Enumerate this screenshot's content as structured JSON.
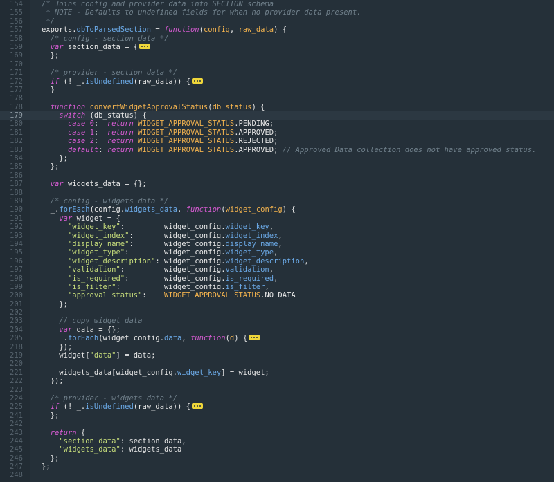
{
  "editor": {
    "active_line": "179",
    "lines": [
      {
        "n": "154",
        "ind": "",
        "t": [
          [
            "/* Joins config and provider data into SECTION schema",
            "c-comment"
          ]
        ]
      },
      {
        "n": "155",
        "ind": " ",
        "t": [
          [
            "* NOTE - Defaults to undefined fields for when no provider data present.",
            "c-comment"
          ]
        ]
      },
      {
        "n": "156",
        "ind": " ",
        "t": [
          [
            "*/",
            "c-comment"
          ]
        ]
      },
      {
        "n": "157",
        "ind": "",
        "t": [
          [
            "exports",
            "c-plain"
          ],
          [
            ".",
            "c-plain"
          ],
          [
            "dbToParsedSection",
            "c-prop"
          ],
          [
            " = ",
            "c-plain"
          ],
          [
            "function",
            "c-kw"
          ],
          [
            "(",
            "c-plain"
          ],
          [
            "config",
            "c-param"
          ],
          [
            ", ",
            "c-plain"
          ],
          [
            "raw_data",
            "c-param"
          ],
          [
            ") {",
            "c-plain"
          ]
        ]
      },
      {
        "n": "158",
        "ind": "  ",
        "t": [
          [
            "/* config - section data */",
            "c-comment"
          ]
        ]
      },
      {
        "n": "159",
        "ind": "  ",
        "t": [
          [
            "var",
            "c-kw"
          ],
          [
            " section_data = {",
            "c-plain"
          ]
        ],
        "fold": true
      },
      {
        "n": "169",
        "ind": "  ",
        "t": [
          [
            "};",
            "c-plain"
          ]
        ]
      },
      {
        "n": "170",
        "ind": "",
        "t": []
      },
      {
        "n": "171",
        "ind": "  ",
        "t": [
          [
            "/* provider - section data */",
            "c-comment"
          ]
        ]
      },
      {
        "n": "172",
        "ind": "  ",
        "t": [
          [
            "if",
            "c-kw"
          ],
          [
            " (! _.",
            "c-plain"
          ],
          [
            "isUndefined",
            "c-prop"
          ],
          [
            "(raw_data)) {",
            "c-plain"
          ]
        ],
        "fold": true
      },
      {
        "n": "177",
        "ind": "  ",
        "t": [
          [
            "}",
            "c-plain"
          ]
        ]
      },
      {
        "n": "178",
        "ind": "",
        "t": []
      },
      {
        "n": "178",
        "ind": "  ",
        "t": [
          [
            "function",
            "c-kw"
          ],
          [
            " ",
            "c-plain"
          ],
          [
            "convertWidgetApprovalStatus",
            "c-func"
          ],
          [
            "(",
            "c-plain"
          ],
          [
            "db_status",
            "c-param"
          ],
          [
            ") {",
            "c-plain"
          ]
        ]
      },
      {
        "n": "179",
        "ind": "    ",
        "t": [
          [
            "switch",
            "c-kw"
          ],
          [
            " (db_status) {",
            "c-plain"
          ]
        ]
      },
      {
        "n": "180",
        "ind": "      ",
        "t": [
          [
            "case",
            "c-kw"
          ],
          [
            " ",
            "c-plain"
          ],
          [
            "0",
            "c-num"
          ],
          [
            ":  ",
            "c-plain"
          ],
          [
            "return",
            "c-kw"
          ],
          [
            " ",
            "c-plain"
          ],
          [
            "WIDGET_APPROVAL_STATUS",
            "c-const"
          ],
          [
            ".PENDING;",
            "c-plain"
          ]
        ]
      },
      {
        "n": "181",
        "ind": "      ",
        "t": [
          [
            "case",
            "c-kw"
          ],
          [
            " ",
            "c-plain"
          ],
          [
            "1",
            "c-num"
          ],
          [
            ":  ",
            "c-plain"
          ],
          [
            "return",
            "c-kw"
          ],
          [
            " ",
            "c-plain"
          ],
          [
            "WIDGET_APPROVAL_STATUS",
            "c-const"
          ],
          [
            ".APPROVED;",
            "c-plain"
          ]
        ]
      },
      {
        "n": "182",
        "ind": "      ",
        "t": [
          [
            "case",
            "c-kw"
          ],
          [
            " ",
            "c-plain"
          ],
          [
            "2",
            "c-num"
          ],
          [
            ":  ",
            "c-plain"
          ],
          [
            "return",
            "c-kw"
          ],
          [
            " ",
            "c-plain"
          ],
          [
            "WIDGET_APPROVAL_STATUS",
            "c-const"
          ],
          [
            ".REJECTED;",
            "c-plain"
          ]
        ]
      },
      {
        "n": "183",
        "ind": "      ",
        "t": [
          [
            "default",
            "c-kw"
          ],
          [
            ": ",
            "c-plain"
          ],
          [
            "return",
            "c-kw"
          ],
          [
            " ",
            "c-plain"
          ],
          [
            "WIDGET_APPROVAL_STATUS",
            "c-const"
          ],
          [
            ".APPROVED; ",
            "c-plain"
          ],
          [
            "// Approved Data collection does not have approved_status.",
            "c-comment"
          ]
        ]
      },
      {
        "n": "184",
        "ind": "    ",
        "t": [
          [
            "};",
            "c-plain"
          ]
        ]
      },
      {
        "n": "185",
        "ind": "  ",
        "t": [
          [
            "};",
            "c-plain"
          ]
        ]
      },
      {
        "n": "186",
        "ind": "",
        "t": []
      },
      {
        "n": "187",
        "ind": "  ",
        "t": [
          [
            "var",
            "c-kw"
          ],
          [
            " widgets_data = {};",
            "c-plain"
          ]
        ]
      },
      {
        "n": "188",
        "ind": "",
        "t": []
      },
      {
        "n": "189",
        "ind": "  ",
        "t": [
          [
            "/* config - widgets data */",
            "c-comment"
          ]
        ]
      },
      {
        "n": "190",
        "ind": "  ",
        "t": [
          [
            "_.",
            "c-plain"
          ],
          [
            "forEach",
            "c-prop"
          ],
          [
            "(config.",
            "c-plain"
          ],
          [
            "widgets_data",
            "c-prop"
          ],
          [
            ", ",
            "c-plain"
          ],
          [
            "function",
            "c-kw"
          ],
          [
            "(",
            "c-plain"
          ],
          [
            "widget_config",
            "c-param"
          ],
          [
            ") {",
            "c-plain"
          ]
        ]
      },
      {
        "n": "191",
        "ind": "    ",
        "t": [
          [
            "var",
            "c-kw"
          ],
          [
            " widget = {",
            "c-plain"
          ]
        ]
      },
      {
        "n": "192",
        "ind": "      ",
        "t": [
          [
            "\"widget_key\"",
            "c-str"
          ],
          [
            ":         widget_config.",
            "c-plain"
          ],
          [
            "widget_key",
            "c-prop"
          ],
          [
            ",",
            "c-plain"
          ]
        ]
      },
      {
        "n": "193",
        "ind": "      ",
        "t": [
          [
            "\"widget_index\"",
            "c-str"
          ],
          [
            ":       widget_config.",
            "c-plain"
          ],
          [
            "widget_index",
            "c-prop"
          ],
          [
            ",",
            "c-plain"
          ]
        ]
      },
      {
        "n": "194",
        "ind": "      ",
        "t": [
          [
            "\"display_name\"",
            "c-str"
          ],
          [
            ":       widget_config.",
            "c-plain"
          ],
          [
            "display_name",
            "c-prop"
          ],
          [
            ",",
            "c-plain"
          ]
        ]
      },
      {
        "n": "195",
        "ind": "      ",
        "t": [
          [
            "\"widget_type\"",
            "c-str"
          ],
          [
            ":        widget_config.",
            "c-plain"
          ],
          [
            "widget_type",
            "c-prop"
          ],
          [
            ",",
            "c-plain"
          ]
        ]
      },
      {
        "n": "196",
        "ind": "      ",
        "t": [
          [
            "\"widget_description\"",
            "c-str"
          ],
          [
            ": widget_config.",
            "c-plain"
          ],
          [
            "widget_description",
            "c-prop"
          ],
          [
            ",",
            "c-plain"
          ]
        ]
      },
      {
        "n": "197",
        "ind": "      ",
        "t": [
          [
            "\"validation\"",
            "c-str"
          ],
          [
            ":         widget_config.",
            "c-plain"
          ],
          [
            "validation",
            "c-prop"
          ],
          [
            ",",
            "c-plain"
          ]
        ]
      },
      {
        "n": "198",
        "ind": "      ",
        "t": [
          [
            "\"is_required\"",
            "c-str"
          ],
          [
            ":        widget_config.",
            "c-plain"
          ],
          [
            "is_required",
            "c-prop"
          ],
          [
            ",",
            "c-plain"
          ]
        ]
      },
      {
        "n": "199",
        "ind": "      ",
        "t": [
          [
            "\"is_filter\"",
            "c-str"
          ],
          [
            ":          widget_config.",
            "c-plain"
          ],
          [
            "is_filter",
            "c-prop"
          ],
          [
            ",",
            "c-plain"
          ]
        ]
      },
      {
        "n": "200",
        "ind": "      ",
        "t": [
          [
            "\"approval_status\"",
            "c-str"
          ],
          [
            ":    ",
            "c-plain"
          ],
          [
            "WIDGET_APPROVAL_STATUS",
            "c-const"
          ],
          [
            ".NO_DATA",
            "c-plain"
          ]
        ]
      },
      {
        "n": "201",
        "ind": "    ",
        "t": [
          [
            "};",
            "c-plain"
          ]
        ]
      },
      {
        "n": "202",
        "ind": "",
        "t": []
      },
      {
        "n": "203",
        "ind": "    ",
        "t": [
          [
            "// copy widget data",
            "c-comment"
          ]
        ]
      },
      {
        "n": "204",
        "ind": "    ",
        "t": [
          [
            "var",
            "c-kw"
          ],
          [
            " data = {};",
            "c-plain"
          ]
        ]
      },
      {
        "n": "205",
        "ind": "    ",
        "t": [
          [
            "_.",
            "c-plain"
          ],
          [
            "forEach",
            "c-prop"
          ],
          [
            "(widget_config.",
            "c-plain"
          ],
          [
            "data",
            "c-prop"
          ],
          [
            ", ",
            "c-plain"
          ],
          [
            "function",
            "c-kw"
          ],
          [
            "(",
            "c-plain"
          ],
          [
            "d",
            "c-param"
          ],
          [
            ") {",
            "c-plain"
          ]
        ],
        "fold": true
      },
      {
        "n": "218",
        "ind": "    ",
        "t": [
          [
            "});",
            "c-plain"
          ]
        ]
      },
      {
        "n": "219",
        "ind": "    ",
        "t": [
          [
            "widget[",
            "c-plain"
          ],
          [
            "\"data\"",
            "c-str"
          ],
          [
            "] = data;",
            "c-plain"
          ]
        ]
      },
      {
        "n": "220",
        "ind": "",
        "t": []
      },
      {
        "n": "221",
        "ind": "    ",
        "t": [
          [
            "widgets_data[widget_config.",
            "c-plain"
          ],
          [
            "widget_key",
            "c-prop"
          ],
          [
            "] = widget;",
            "c-plain"
          ]
        ]
      },
      {
        "n": "222",
        "ind": "  ",
        "t": [
          [
            "});",
            "c-plain"
          ]
        ]
      },
      {
        "n": "223",
        "ind": "",
        "t": []
      },
      {
        "n": "224",
        "ind": "  ",
        "t": [
          [
            "/* provider - widgets data */",
            "c-comment"
          ]
        ]
      },
      {
        "n": "225",
        "ind": "  ",
        "t": [
          [
            "if",
            "c-kw"
          ],
          [
            " (! _.",
            "c-plain"
          ],
          [
            "isUndefined",
            "c-prop"
          ],
          [
            "(raw_data)) {",
            "c-plain"
          ]
        ],
        "fold": true
      },
      {
        "n": "241",
        "ind": "  ",
        "t": [
          [
            "};",
            "c-plain"
          ]
        ]
      },
      {
        "n": "242",
        "ind": "",
        "t": []
      },
      {
        "n": "243",
        "ind": "  ",
        "t": [
          [
            "return",
            "c-kw"
          ],
          [
            " {",
            "c-plain"
          ]
        ]
      },
      {
        "n": "244",
        "ind": "    ",
        "t": [
          [
            "\"section_data\"",
            "c-str"
          ],
          [
            ": section_data,",
            "c-plain"
          ]
        ]
      },
      {
        "n": "245",
        "ind": "    ",
        "t": [
          [
            "\"widgets_data\"",
            "c-str"
          ],
          [
            ": widgets_data",
            "c-plain"
          ]
        ]
      },
      {
        "n": "246",
        "ind": "  ",
        "t": [
          [
            "};",
            "c-plain"
          ]
        ]
      },
      {
        "n": "247",
        "ind": "",
        "t": [
          [
            "};",
            "c-plain"
          ]
        ]
      },
      {
        "n": "248",
        "ind": "",
        "t": []
      }
    ]
  }
}
